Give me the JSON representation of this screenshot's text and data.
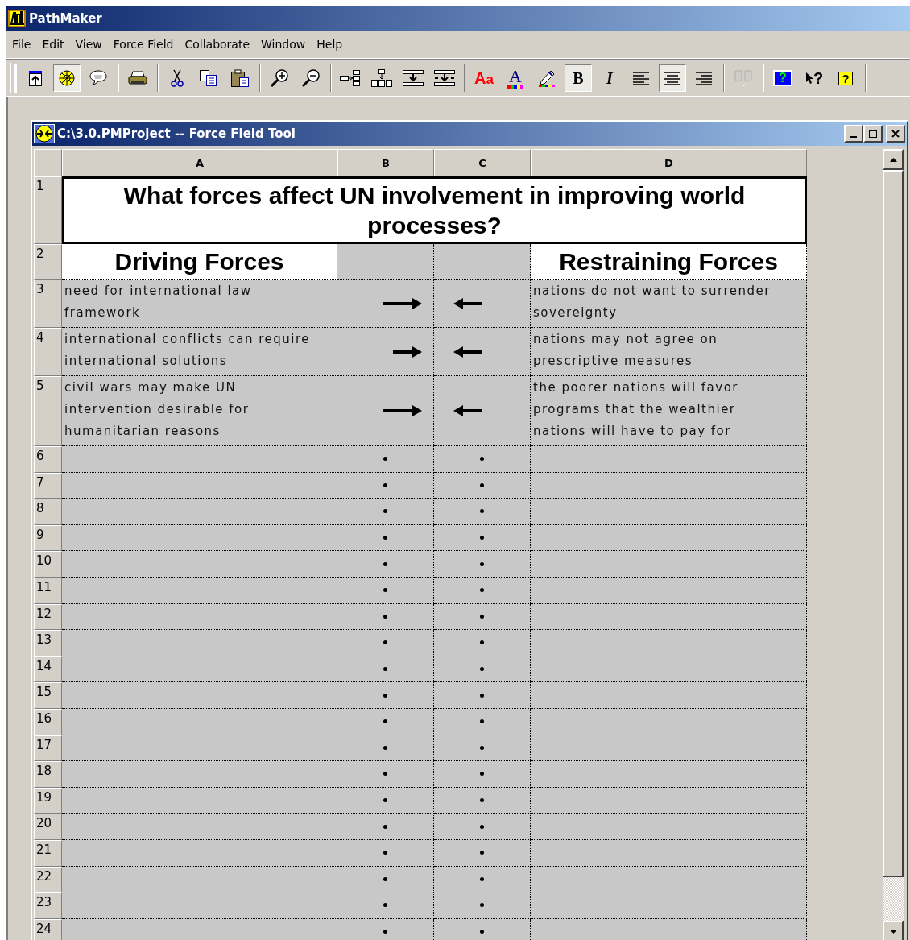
{
  "app": {
    "title": "PathMaker"
  },
  "menu": [
    {
      "label": "File"
    },
    {
      "label": "Edit"
    },
    {
      "label": "View"
    },
    {
      "label": "Force Field"
    },
    {
      "label": "Collaborate"
    },
    {
      "label": "Window"
    },
    {
      "label": "Help"
    }
  ],
  "toolbar": {
    "groups": [
      [
        {
          "kind": "new-node",
          "pressed": false,
          "disabled": false
        },
        {
          "kind": "wheel",
          "pressed": true,
          "disabled": false
        },
        {
          "kind": "speech",
          "pressed": false,
          "disabled": false
        }
      ],
      [
        {
          "kind": "print",
          "pressed": false,
          "disabled": false
        }
      ],
      [
        {
          "kind": "cut",
          "pressed": false,
          "disabled": false
        },
        {
          "kind": "copy",
          "pressed": false,
          "disabled": false
        },
        {
          "kind": "paste",
          "pressed": false,
          "disabled": false
        }
      ],
      [
        {
          "kind": "zoom-in",
          "pressed": false,
          "disabled": false
        },
        {
          "kind": "zoom-out",
          "pressed": false,
          "disabled": false
        }
      ],
      [
        {
          "kind": "tree-right",
          "pressed": false,
          "disabled": false
        },
        {
          "kind": "tree-down",
          "pressed": false,
          "disabled": false
        },
        {
          "kind": "insert-row",
          "pressed": false,
          "disabled": false
        },
        {
          "kind": "insert-row-below",
          "pressed": false,
          "disabled": false
        }
      ],
      [
        {
          "kind": "font-size",
          "glyph": "Aa",
          "pressed": false,
          "disabled": false
        },
        {
          "kind": "font-color",
          "glyph": "A",
          "pressed": false,
          "disabled": false
        },
        {
          "kind": "highlight",
          "pressed": false,
          "disabled": false
        },
        {
          "kind": "bold",
          "glyph": "B",
          "pressed": true,
          "disabled": false
        },
        {
          "kind": "italic",
          "glyph": "I",
          "pressed": false,
          "disabled": false
        },
        {
          "kind": "align-left",
          "pressed": false,
          "disabled": false
        },
        {
          "kind": "align-center",
          "pressed": true,
          "disabled": false
        },
        {
          "kind": "align-right",
          "pressed": false,
          "disabled": false
        }
      ],
      [
        {
          "kind": "masks",
          "pressed": false,
          "disabled": true
        }
      ],
      [
        {
          "kind": "help",
          "glyph": "?",
          "pressed": false,
          "disabled": false
        },
        {
          "kind": "whats-this",
          "glyph": "?",
          "pressed": false,
          "disabled": false
        },
        {
          "kind": "help-book",
          "glyph": "?",
          "pressed": false,
          "disabled": false
        }
      ]
    ]
  },
  "document": {
    "title": "C:\\3.0.PMProject -- Force Field Tool",
    "columns": [
      "A",
      "B",
      "C",
      "D"
    ],
    "question": {
      "row": "1",
      "text": "What forces affect UN involvement in improving world processes?"
    },
    "headings": {
      "row": "2",
      "driving": "Driving Forces",
      "restraining": "Restraining Forces"
    },
    "rows": [
      {
        "row": "3",
        "driving": "need for international law\nframework",
        "driving_arrow": true,
        "driving_long": true,
        "restraining_arrow": true,
        "restraining": "nations do not want to surrender\nsovereignty"
      },
      {
        "row": "4",
        "driving": "international conflicts can require\ninternational solutions",
        "driving_arrow": true,
        "driving_long": false,
        "restraining_arrow": true,
        "restraining": "nations may not agree on\nprescriptive measures"
      },
      {
        "row": "5",
        "driving": "civil wars may make UN\nintervention desirable for\nhumanitarian reasons",
        "driving_arrow": true,
        "driving_long": true,
        "restraining_arrow": true,
        "restraining": "the poorer nations will favor\nprograms that the wealthier\nnations will have to pay for"
      },
      {
        "row": "6",
        "driving_arrow": false,
        "restraining_arrow": false
      },
      {
        "row": "7",
        "driving_arrow": false,
        "restraining_arrow": false
      },
      {
        "row": "8",
        "driving_arrow": false,
        "restraining_arrow": false
      },
      {
        "row": "9",
        "driving_arrow": false,
        "restraining_arrow": false
      },
      {
        "row": "10",
        "driving_arrow": false,
        "restraining_arrow": false
      },
      {
        "row": "11",
        "driving_arrow": false,
        "restraining_arrow": false
      },
      {
        "row": "12",
        "driving_arrow": false,
        "restraining_arrow": false
      },
      {
        "row": "13",
        "driving_arrow": false,
        "restraining_arrow": false
      },
      {
        "row": "14",
        "driving_arrow": false,
        "restraining_arrow": false
      },
      {
        "row": "15",
        "driving_arrow": false,
        "restraining_arrow": false
      },
      {
        "row": "16",
        "driving_arrow": false,
        "restraining_arrow": false
      },
      {
        "row": "17",
        "driving_arrow": false,
        "restraining_arrow": false
      },
      {
        "row": "18",
        "driving_arrow": false,
        "restraining_arrow": false
      },
      {
        "row": "19",
        "driving_arrow": false,
        "restraining_arrow": false
      },
      {
        "row": "20",
        "driving_arrow": false,
        "restraining_arrow": false
      },
      {
        "row": "21",
        "driving_arrow": false,
        "restraining_arrow": false
      },
      {
        "row": "22",
        "driving_arrow": false,
        "restraining_arrow": false
      },
      {
        "row": "23",
        "driving_arrow": false,
        "restraining_arrow": false
      },
      {
        "row": "24",
        "driving_arrow": false,
        "restraining_arrow": false
      }
    ]
  }
}
